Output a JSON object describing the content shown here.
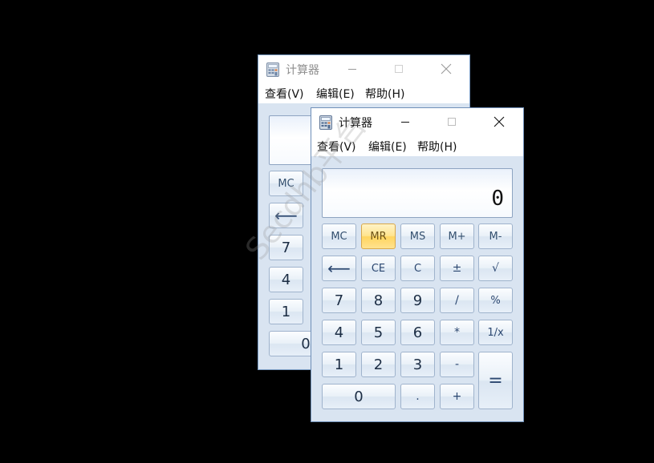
{
  "back_window": {
    "title": "计算器",
    "menu": [
      "查看(V)",
      "编辑(E)",
      "帮助(H)"
    ],
    "visible_buttons": [
      "MC",
      "⟵",
      "7",
      "4",
      "1",
      "0"
    ]
  },
  "front_window": {
    "title": "计算器",
    "menu": [
      "查看(V)",
      "编辑(E)",
      "帮助(H)"
    ],
    "display": "0",
    "rows": [
      [
        "MC",
        "MR",
        "MS",
        "M+",
        "M-"
      ],
      [
        "⟵",
        "CE",
        "C",
        "±",
        "√"
      ],
      [
        "7",
        "8",
        "9",
        "/",
        "%"
      ],
      [
        "4",
        "5",
        "6",
        "*",
        "1/x"
      ],
      [
        "1",
        "2",
        "3",
        "-",
        "="
      ],
      [
        "0",
        ".",
        "+"
      ]
    ],
    "highlighted_button": "MR"
  },
  "icons": {
    "app": "calculator-icon",
    "minimize": "minimize-icon",
    "maximize": "maximize-icon",
    "close": "close-icon"
  },
  "watermark": "Secdhb平台",
  "colors": {
    "desktop": "#000000",
    "client_bg": "#d9e4f1",
    "button_border": "#9fb3cc",
    "highlight": "#ffd55f"
  }
}
